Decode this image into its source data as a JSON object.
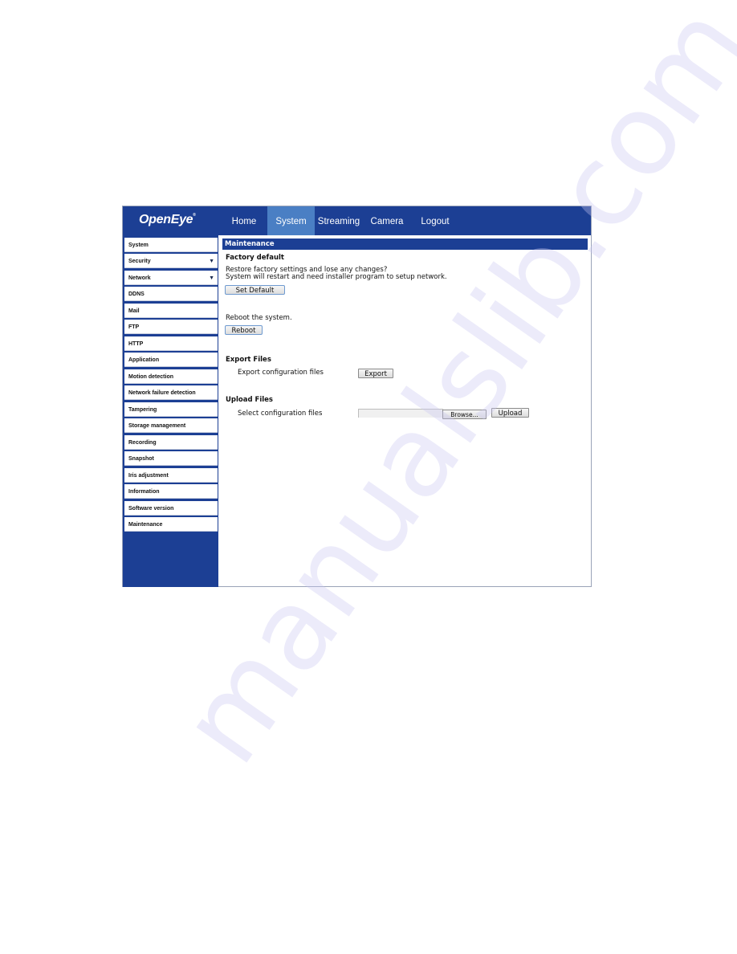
{
  "brand": {
    "logo_text": "OpenEye",
    "trademark": "®"
  },
  "colors": {
    "header_bg": "#1c3f94",
    "active_tab_bg": "#4a7fc4",
    "section_bar_bg": "#1c3f94"
  },
  "nav": {
    "items": [
      {
        "label": "Home",
        "active": false
      },
      {
        "label": "System",
        "active": true
      },
      {
        "label": "Streaming",
        "active": false
      },
      {
        "label": "Camera",
        "active": false
      },
      {
        "label": "Logout",
        "active": false
      }
    ]
  },
  "sidebar": {
    "items": [
      {
        "label": "System",
        "has_submenu": false
      },
      {
        "label": "Security",
        "has_submenu": true
      },
      {
        "label": "Network",
        "has_submenu": true
      },
      {
        "label": "DDNS",
        "has_submenu": false
      },
      {
        "label": "Mail",
        "has_submenu": false
      },
      {
        "label": "FTP",
        "has_submenu": false
      },
      {
        "label": "HTTP",
        "has_submenu": false
      },
      {
        "label": "Application",
        "has_submenu": false
      },
      {
        "label": "Motion detection",
        "has_submenu": false
      },
      {
        "label": "Network failure detection",
        "has_submenu": false
      },
      {
        "label": "Tampering",
        "has_submenu": false
      },
      {
        "label": "Storage management",
        "has_submenu": false
      },
      {
        "label": "Recording",
        "has_submenu": false
      },
      {
        "label": "Snapshot",
        "has_submenu": false
      },
      {
        "label": "Iris adjustment",
        "has_submenu": false
      },
      {
        "label": "Information",
        "has_submenu": false
      },
      {
        "label": "Software version",
        "has_submenu": false
      },
      {
        "label": "Maintenance",
        "has_submenu": false
      }
    ],
    "caret_glyph": "▼"
  },
  "main": {
    "section_title": "Maintenance",
    "factory_default": {
      "heading": "Factory default",
      "line1": "Restore factory settings and lose any changes?",
      "line2": "System will restart and need installer program to setup network.",
      "button": "Set Default"
    },
    "reboot": {
      "text": "Reboot the system.",
      "button": "Reboot"
    },
    "export": {
      "heading": "Export Files",
      "label": "Export configuration files",
      "button": "Export"
    },
    "upload": {
      "heading": "Upload Files",
      "label": "Select configuration files",
      "file_value": "",
      "browse_button": "Browse...",
      "upload_button": "Upload"
    }
  },
  "watermark": {
    "text": "manualslib.com"
  }
}
